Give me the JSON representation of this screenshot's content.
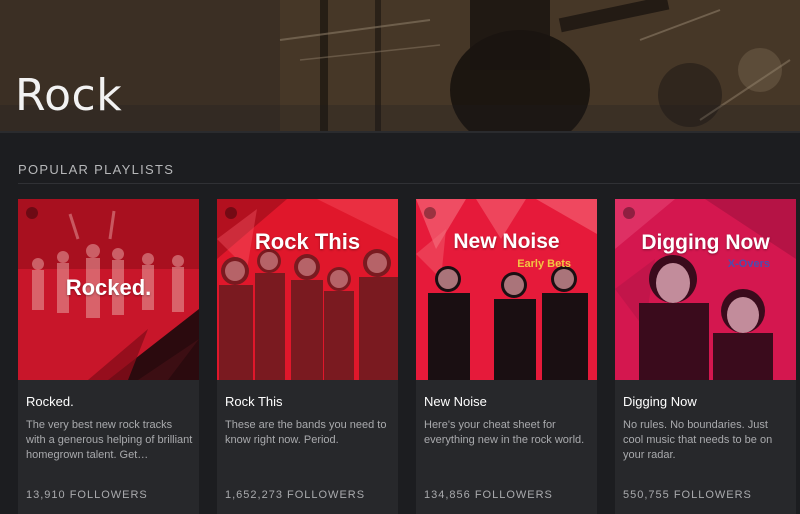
{
  "hero": {
    "title": "Rock"
  },
  "section": {
    "title": "POPULAR PLAYLISTS"
  },
  "playlists": [
    {
      "cover_title": "Rocked.",
      "cover_subtitle": "",
      "name": "Rocked.",
      "description": "The very best new rock tracks with a generous helping of brilliant homegrown talent. Get…",
      "followers": "13,910 FOLLOWERS"
    },
    {
      "cover_title": "Rock This",
      "cover_subtitle": "",
      "name": "Rock This",
      "description": "These are the bands you need to know right now. Period.",
      "followers": "1,652,273 FOLLOWERS"
    },
    {
      "cover_title": "New Noise",
      "cover_subtitle": "Early Bets",
      "name": "New Noise",
      "description": "Here's your cheat sheet for everything new in the rock world.",
      "followers": "134,856 FOLLOWERS"
    },
    {
      "cover_title": "Digging Now",
      "cover_subtitle": "X-Overs",
      "name": "Digging Now",
      "description": "No rules. No boundaries. Just cool music that needs to be on your radar.",
      "followers": "550,755 FOLLOWERS"
    }
  ],
  "colors": {
    "background": "#1c1d20",
    "card": "#27282b",
    "cover_red": "#e8192c",
    "cover_magenta": "#d61f5a",
    "text_muted": "#a9aaad"
  },
  "icons": [
    "spotify-logo-icon"
  ]
}
